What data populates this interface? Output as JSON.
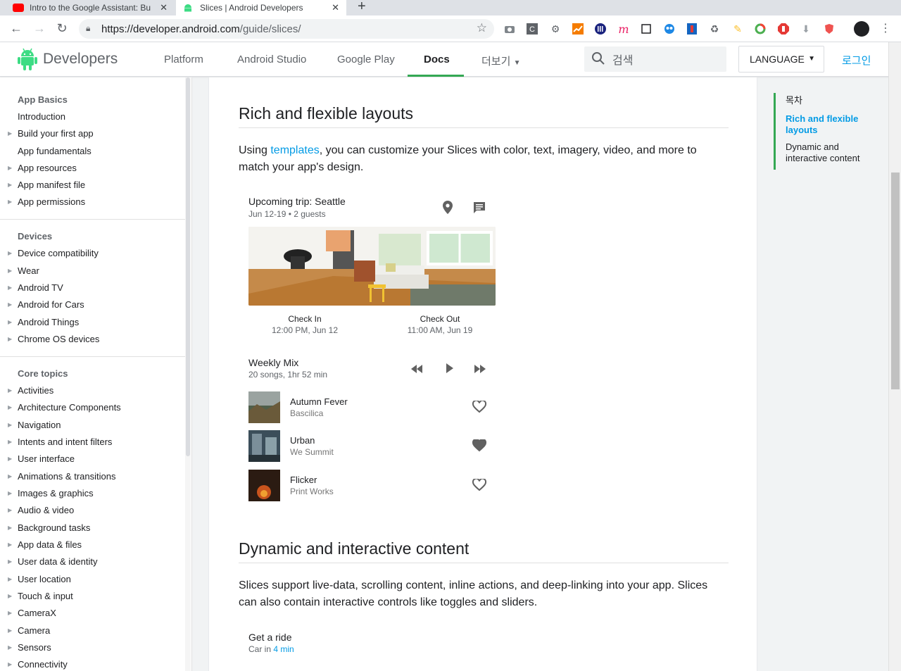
{
  "browser": {
    "tabs": [
      {
        "title": "Intro to the Google Assistant: Bu",
        "favicon_color": "#ff0000"
      },
      {
        "title": "Slices  |  Android Developers",
        "favicon_color": "#3ddc84"
      }
    ],
    "new_tab_label": "+",
    "close_label": "✕",
    "url_host": "https://developer.android.com",
    "url_path": "/guide/slices/"
  },
  "header": {
    "logo_text": "Developers",
    "nav": [
      "Platform",
      "Android Studio",
      "Google Play",
      "Docs",
      "더보기"
    ],
    "active_nav": "Docs",
    "search_placeholder": "검색",
    "language_label": "LANGUAGE",
    "login_label": "로그인"
  },
  "sidebar": {
    "sections": [
      {
        "title": "App Basics",
        "items": [
          {
            "label": "Introduction",
            "expandable": false
          },
          {
            "label": "Build your first app",
            "expandable": true
          },
          {
            "label": "App fundamentals",
            "expandable": false
          },
          {
            "label": "App resources",
            "expandable": true
          },
          {
            "label": "App manifest file",
            "expandable": true
          },
          {
            "label": "App permissions",
            "expandable": true
          }
        ]
      },
      {
        "title": "Devices",
        "items": [
          {
            "label": "Device compatibility",
            "expandable": true
          },
          {
            "label": "Wear",
            "expandable": true
          },
          {
            "label": "Android TV",
            "expandable": true
          },
          {
            "label": "Android for Cars",
            "expandable": true
          },
          {
            "label": "Android Things",
            "expandable": true
          },
          {
            "label": "Chrome OS devices",
            "expandable": true
          }
        ]
      },
      {
        "title": "Core topics",
        "items": [
          {
            "label": "Activities",
            "expandable": true
          },
          {
            "label": "Architecture Components",
            "expandable": true
          },
          {
            "label": "Navigation",
            "expandable": true
          },
          {
            "label": "Intents and intent filters",
            "expandable": true
          },
          {
            "label": "User interface",
            "expandable": true
          },
          {
            "label": "Animations & transitions",
            "expandable": true
          },
          {
            "label": "Images & graphics",
            "expandable": true
          },
          {
            "label": "Audio & video",
            "expandable": true
          },
          {
            "label": "Background tasks",
            "expandable": true
          },
          {
            "label": "App data & files",
            "expandable": true
          },
          {
            "label": "User data & identity",
            "expandable": true
          },
          {
            "label": "User location",
            "expandable": true
          },
          {
            "label": "Touch & input",
            "expandable": true
          },
          {
            "label": "CameraX",
            "expandable": true
          },
          {
            "label": "Camera",
            "expandable": true
          },
          {
            "label": "Sensors",
            "expandable": true
          },
          {
            "label": "Connectivity",
            "expandable": true
          }
        ]
      }
    ]
  },
  "main": {
    "section1": {
      "heading": "Rich and flexible layouts",
      "para_before": "Using ",
      "para_link": "templates",
      "para_after": ", you can customize your Slices with color, text, imagery, video, and more to match your app's design."
    },
    "trip_card": {
      "title": "Upcoming trip: Seattle",
      "subtitle": "Jun 12-19 • 2 guests",
      "check_in_label": "Check In",
      "check_in_value": "12:00 PM, Jun 12",
      "check_out_label": "Check Out",
      "check_out_value": "11:00 AM, Jun 19"
    },
    "music_card": {
      "title": "Weekly Mix",
      "subtitle": "20 songs, 1hr 52 min",
      "songs": [
        {
          "title": "Autumn Fever",
          "artist": "Bascilica",
          "liked": false
        },
        {
          "title": "Urban",
          "artist": "We Summit",
          "liked": true
        },
        {
          "title": "Flicker",
          "artist": "Print Works",
          "liked": false
        }
      ]
    },
    "section2": {
      "heading": "Dynamic and interactive content",
      "para": "Slices support live-data, scrolling content, inline actions, and deep-linking into your app. Slices can also contain interactive controls like toggles and sliders."
    },
    "ride_card": {
      "title": "Get a ride",
      "subtitle_prefix": "Car in ",
      "subtitle_link": "4 min"
    }
  },
  "toc": {
    "title": "목차",
    "items": [
      {
        "label": "Rich and flexible layouts",
        "active": true
      },
      {
        "label": "Dynamic and interactive content",
        "active": false
      }
    ]
  },
  "colors": {
    "accent_link": "#039be5",
    "android_green": "#3ddc84",
    "nav_underline": "#34a853"
  }
}
